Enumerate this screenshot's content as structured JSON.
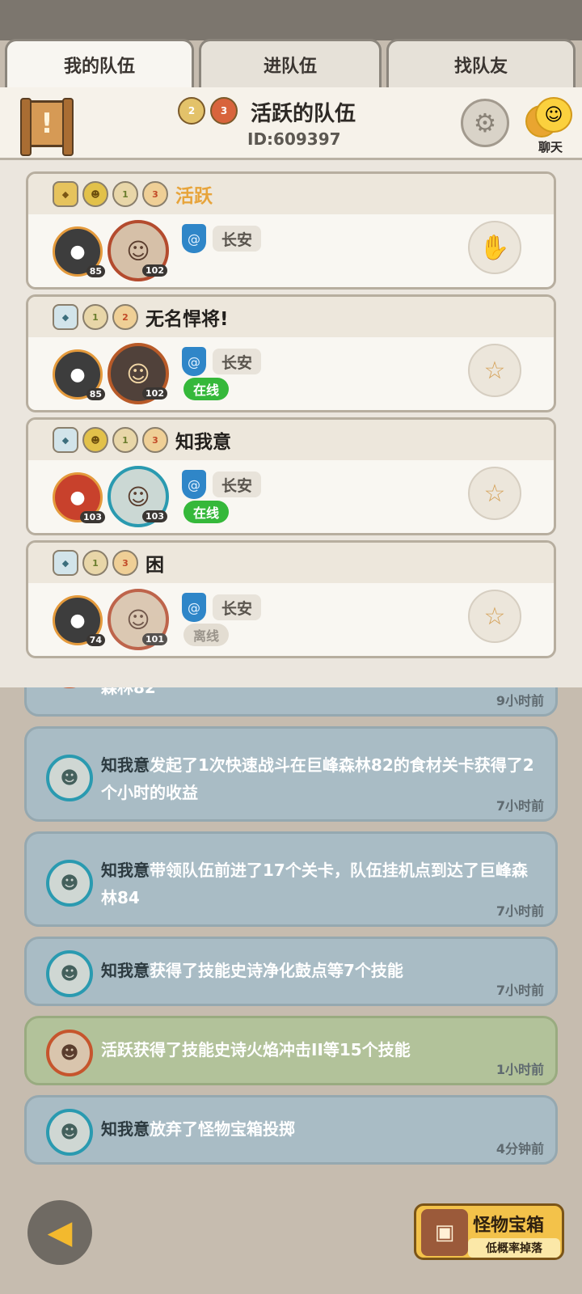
{
  "tabs": [
    {
      "label": "我的队伍",
      "active": true
    },
    {
      "label": "进队伍",
      "active": false
    },
    {
      "label": "找队友",
      "active": false
    }
  ],
  "header": {
    "team_name": "活跃的队伍",
    "team_id": "ID:609397",
    "medals": [
      "2",
      "3"
    ],
    "chat_label": "聊天",
    "scroll_icon": "!"
  },
  "members": [
    {
      "name": "活跃",
      "name_style": "orange",
      "pet_level": "85",
      "hero_level": "102",
      "city": "长安",
      "status": ""
    },
    {
      "name": "无名悍将!",
      "name_style": "",
      "pet_level": "85",
      "hero_level": "102",
      "city": "长安",
      "status": "在线"
    },
    {
      "name": "知我意",
      "name_style": "",
      "pet_level": "103",
      "hero_level": "103",
      "city": "长安",
      "status": "在线"
    },
    {
      "name": "困",
      "name_style": "",
      "pet_level": "74",
      "hero_level": "101",
      "city": "长安",
      "status": "离线"
    }
  ],
  "member_badges": {
    "crest": "1",
    "rank": "3"
  },
  "feed": [
    {
      "text": "森林82",
      "time": "9小时前"
    },
    {
      "name": "知我意",
      "text": "发起了1次快速战斗在巨峰森林82的食材关卡获得了2个小时的收益",
      "time": "7小时前"
    },
    {
      "name": "知我意",
      "text": "带领队伍前进了17个关卡，队伍挂机点到达了巨峰森林84",
      "time": "7小时前"
    },
    {
      "name": "知我意",
      "text": "获得了技能史诗净化鼓点等7个技能",
      "time": "7小时前"
    },
    {
      "name": "活跃",
      "text": "获得了技能史诗火焰冲击II等15个技能",
      "time": "1小时前"
    },
    {
      "name": "知我意",
      "text": "放弃了怪物宝箱投掷",
      "time": "4分钟前"
    }
  ],
  "bottom": {
    "chest_title": "怪物宝箱",
    "chest_sub": "低概率掉落"
  },
  "colors": {
    "accent_orange": "#e7a43b",
    "online_green": "#35b83a",
    "feed_blue": "#a9bcc5",
    "feed_green": "#b2c29a"
  }
}
